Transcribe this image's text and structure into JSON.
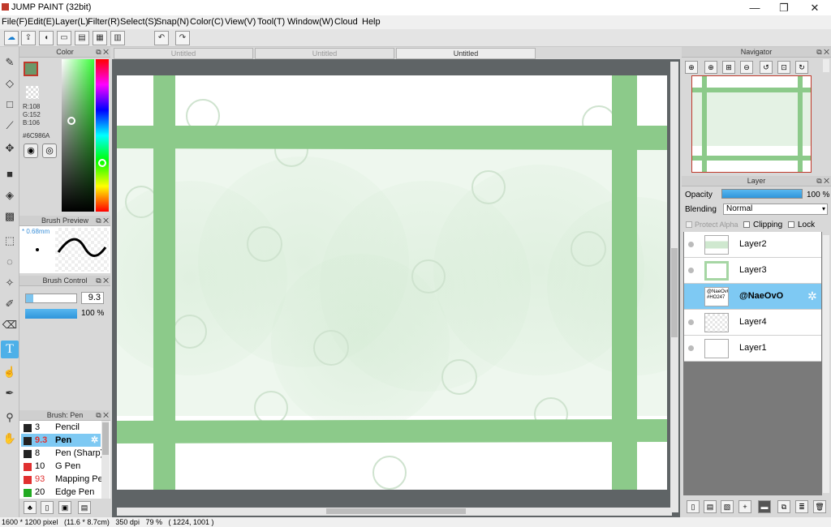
{
  "app": {
    "title": "JUMP PAINT (32bit)",
    "minimize_glyph": "—",
    "restore_glyph": "❐",
    "close_glyph": "✕"
  },
  "menu": [
    "File(F)",
    "Edit(E)",
    "Layer(L)",
    "Filter(R)",
    "Select(S)",
    "Snap(N)",
    "Color(C)",
    "View(V)",
    "Tool(T)",
    "Window(W)",
    "Cloud",
    "Help"
  ],
  "color_panel": {
    "title": "Color",
    "r": "R:108",
    "g": "G:152",
    "b": "B:106",
    "hex": "#6C986A",
    "swatch": "#6C986A"
  },
  "brush_preview": {
    "title": "Brush Preview",
    "size": "* 0.68mm"
  },
  "brush_control": {
    "title": "Brush Control",
    "size_value": "9.3",
    "opacity_value": "100 %"
  },
  "brush_list": {
    "title": "Brush: Pen",
    "items": [
      {
        "num": "3",
        "name": "Pencil",
        "color": "#222222",
        "selected": false
      },
      {
        "num": "9.3",
        "name": "Pen",
        "color": "#222222",
        "selected": true
      },
      {
        "num": "8",
        "name": "Pen (Sharp)",
        "color": "#222222",
        "selected": false
      },
      {
        "num": "10",
        "name": "G Pen",
        "color": "#e03030",
        "selected": false
      },
      {
        "num": "93",
        "name": "Mapping Pe",
        "color": "#e03030",
        "selected": false
      },
      {
        "num": "20",
        "name": "Edge Pen",
        "color": "#22aa22",
        "selected": false
      }
    ]
  },
  "doc_tabs": [
    "Untitled",
    "Untitled",
    "Untitled"
  ],
  "navigator": {
    "title": "Navigator"
  },
  "layer_panel": {
    "title": "Layer",
    "opacity_label": "Opacity",
    "opacity_value": "100 %",
    "blending_label": "Blending",
    "blending_value": "Normal",
    "protect_alpha": "Protect Alpha",
    "clipping": "Clipping",
    "lock": "Lock",
    "layers": [
      {
        "name": "Layer2",
        "selected": false
      },
      {
        "name": "Layer3",
        "selected": false
      },
      {
        "name": "@NaeOvO",
        "selected": true,
        "thumb_text": "@NaeOvO #HO247"
      },
      {
        "name": "Layer4",
        "selected": false
      },
      {
        "name": "Layer1",
        "selected": false
      }
    ]
  },
  "status": {
    "text": "1600 * 1200 pixel   (11.6 * 8.7cm)   350 dpi   79 %   ( 1224, 1001 )"
  }
}
